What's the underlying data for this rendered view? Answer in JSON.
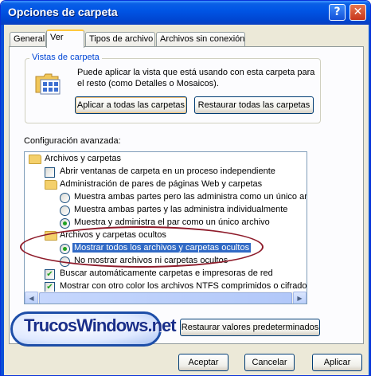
{
  "window": {
    "title": "Opciones de carpeta"
  },
  "tabs": [
    {
      "label": "General"
    },
    {
      "label": "Ver"
    },
    {
      "label": "Tipos de archivo"
    },
    {
      "label": "Archivos sin conexión"
    }
  ],
  "folder_views": {
    "legend": "Vistas de carpeta",
    "description_line1": "Puede aplicar la vista que está usando con esta carpeta para",
    "description_line2": "el resto (como Detalles o Mosaicos).",
    "apply_all_label": "Aplicar a todas las carpetas",
    "reset_all_label": "Restaurar todas las carpetas"
  },
  "advanced": {
    "label": "Configuración avanzada:",
    "rows": [
      {
        "kind": "folder",
        "text": "Archivos y carpetas"
      },
      {
        "kind": "check",
        "checked": false,
        "text": "Abrir ventanas de carpeta  en un proceso independiente"
      },
      {
        "kind": "folder",
        "text": "Administración de pares de páginas Web y carpetas"
      },
      {
        "kind": "radio",
        "checked": false,
        "text": "Muestra ambas partes pero las administra como un único archi"
      },
      {
        "kind": "radio",
        "checked": false,
        "text": "Muestra ambas partes y las administra individualmente"
      },
      {
        "kind": "radio",
        "checked": true,
        "text": "Muestra y administra el par como un único archivo"
      },
      {
        "kind": "folder",
        "text": "Archivos y carpetas ocultos"
      },
      {
        "kind": "radio",
        "checked": true,
        "selected": true,
        "text": "Mostrar todos los archivos y carpetas ocultos"
      },
      {
        "kind": "radio",
        "checked": false,
        "text": "No mostrar archivos ni carpetas ocultos"
      },
      {
        "kind": "check",
        "checked": true,
        "text": "Buscar automáticamente carpetas e impresoras de red"
      },
      {
        "kind": "check",
        "checked": true,
        "text": "Mostrar con otro color los archivos NTFS comprimidos o cifrados"
      }
    ],
    "restore_defaults_label": "Restaurar valores predeterminados"
  },
  "watermark": {
    "text": "TrucosWindows.net"
  },
  "footer": {
    "accept_label": "Aceptar",
    "cancel_label": "Cancelar",
    "apply_label": "Aplicar"
  }
}
